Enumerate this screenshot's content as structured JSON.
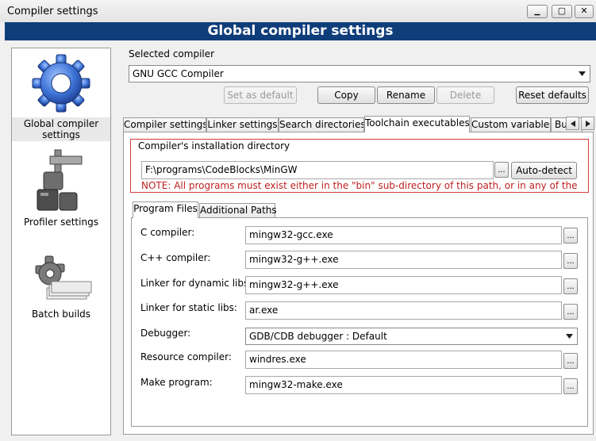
{
  "window": {
    "title": "Compiler settings",
    "header": "Global compiler settings",
    "controls": {
      "minimize": "▁",
      "maximize": "▢",
      "close": "✕"
    }
  },
  "sidebar": {
    "items": [
      {
        "label": "Global compiler settings",
        "icon": "gear-icon",
        "selected": true
      },
      {
        "label": "Profiler settings",
        "icon": "profiler-icon",
        "selected": false
      },
      {
        "label": "Batch builds",
        "icon": "batch-builds-icon",
        "selected": false
      }
    ]
  },
  "compiler": {
    "label": "Selected compiler",
    "selected": "GNU GCC Compiler"
  },
  "buttons": {
    "set_default": "Set as default",
    "copy": "Copy",
    "rename": "Rename",
    "delete": "Delete",
    "reset_defaults": "Reset defaults"
  },
  "tabs": [
    {
      "label": "Compiler settings",
      "active": false
    },
    {
      "label": "Linker settings",
      "active": false
    },
    {
      "label": "Search directories",
      "active": false
    },
    {
      "label": "Toolchain executables",
      "active": true
    },
    {
      "label": "Custom variables",
      "active": false
    },
    {
      "label": "Build",
      "active": false
    }
  ],
  "install": {
    "group_label": "Compiler's installation directory",
    "path": "F:\\programs\\CodeBlocks\\MinGW",
    "browse": "...",
    "autodetect": "Auto-detect",
    "note": "NOTE: All programs must exist either in the \"bin\" sub-directory of this path, or in any of the"
  },
  "inner_tabs": [
    {
      "label": "Program Files",
      "active": true
    },
    {
      "label": "Additional Paths",
      "active": false
    }
  ],
  "programs": [
    {
      "label": "C compiler:",
      "value": "mingw32-gcc.exe",
      "kind": "text"
    },
    {
      "label": "C++ compiler:",
      "value": "mingw32-g++.exe",
      "kind": "text"
    },
    {
      "label": "Linker for dynamic libs:",
      "value": "mingw32-g++.exe",
      "kind": "text"
    },
    {
      "label": "Linker for static libs:",
      "value": "ar.exe",
      "kind": "text"
    },
    {
      "label": "Debugger:",
      "value": "GDB/CDB debugger : Default",
      "kind": "select"
    },
    {
      "label": "Resource compiler:",
      "value": "windres.exe",
      "kind": "text"
    },
    {
      "label": "Make program:",
      "value": "mingw32-make.exe",
      "kind": "text"
    }
  ],
  "browse_label": "...",
  "colors": {
    "header_bg": "#0f3d7a",
    "note_red": "#c02020",
    "frame_red": "#d43a3a"
  }
}
